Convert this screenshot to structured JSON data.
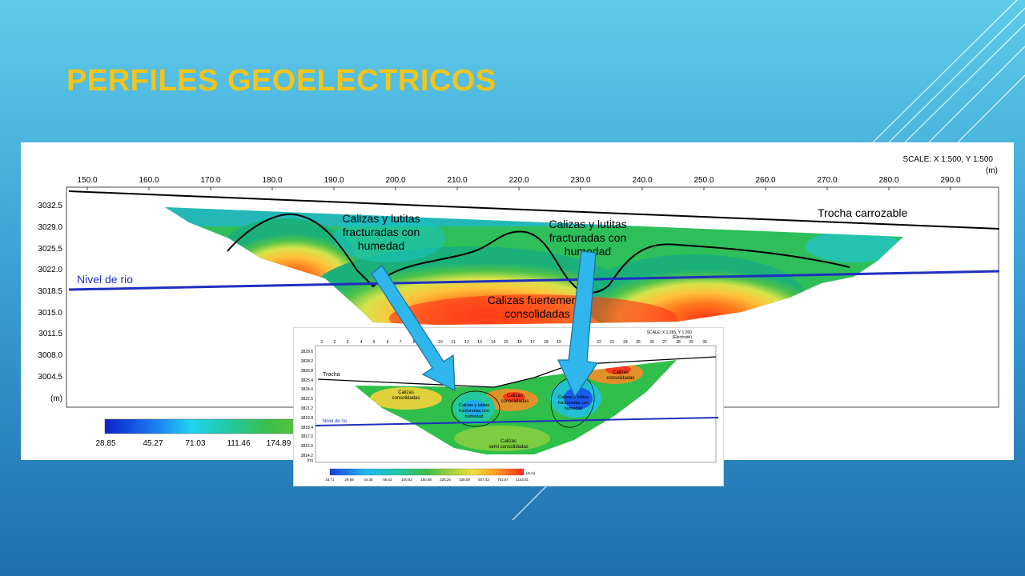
{
  "slide": {
    "title": "PERFILES GEOELECTRICOS"
  },
  "main_profile": {
    "scale_label": "SCALE: X 1:500, Y 1:500",
    "unit_label": "(m)",
    "x_ticks": [
      "150.0",
      "160.0",
      "170.0",
      "180.0",
      "190.0",
      "200.0",
      "210.0",
      "220.0",
      "230.0",
      "240.0",
      "250.0",
      "260.0",
      "270.0",
      "280.0",
      "290.0"
    ],
    "y_ticks": [
      "3032.5",
      "3029.0",
      "3025.5",
      "3022.0",
      "3018.5",
      "3015.0",
      "3011.5",
      "3008.0",
      "3004.5"
    ],
    "y_unit": "(m)",
    "annotations": {
      "trocha": "Trocha carrozable",
      "nivel": "Nivel de rio",
      "fract1_l1": "Calizas y lutitas",
      "fract1_l2": "fracturadas con",
      "fract1_l3": "humedad",
      "fract2_l1": "Calizas y lutitas",
      "fract2_l2": "fracturadas con",
      "fract2_l3": "humedad",
      "consol_l1": "Calizas fuertemente",
      "consol_l2": "consolidadas"
    },
    "legend_values": [
      "28.85",
      "45.27",
      "71.03",
      "111.46",
      "174.89"
    ]
  },
  "inset_profile": {
    "scale_label": "SCALE: X 1:265, Y 1:260",
    "electrode_label": "(Electrode)",
    "x_ticks": [
      "1",
      "2",
      "3",
      "4",
      "5",
      "6",
      "7",
      "8",
      "9",
      "10",
      "11",
      "12",
      "13",
      "14",
      "15",
      "16",
      "17",
      "18",
      "19",
      "20",
      "21",
      "22",
      "23",
      "24",
      "25",
      "26",
      "27",
      "28",
      "29",
      "30"
    ],
    "y_ticks": [
      "3829.6",
      "3828.2",
      "3826.8",
      "3825.4",
      "3824.0",
      "3822.6",
      "3821.2",
      "3819.8",
      "3818.4",
      "3817.0",
      "3815.6",
      "3814.2"
    ],
    "y_unit": "(m)",
    "annotations": {
      "trocha": "Trocha",
      "nivel": "Nivel de rio",
      "a1_l1": "Calizas",
      "a1_l2": "consolidadas",
      "a2_l1": "Calizas",
      "a2_l2": "consolidadas",
      "a3_l1": "Calizas",
      "a3_l2": "consolidadas",
      "f1_l1": "Calizas y lutitas",
      "f1_l2": "fracturadas con",
      "f1_l3": "humedad",
      "f2_l1": "Calizas y lutitas",
      "f2_l2": "fracturadas con",
      "f2_l3": "humedad",
      "semi_l1": "Calizas",
      "semi_l2": "semi consolidadas"
    },
    "legend_values": [
      "18.71",
      "29.58",
      "44.35",
      "66.63",
      "100.83",
      "150.08",
      "225.26",
      "338.08",
      "507.42",
      "761.57",
      "1143.81"
    ],
    "legend_unit": "(Ω.m)"
  },
  "colors": {
    "title": "#f3c51a",
    "river_line": "#1f2fbf",
    "arrow": "#2fb6ec"
  }
}
